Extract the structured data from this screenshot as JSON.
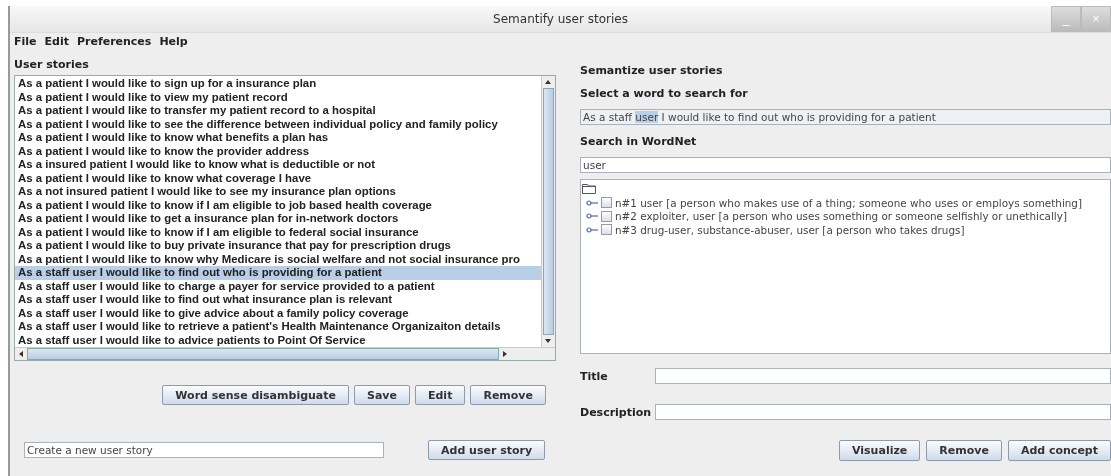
{
  "window": {
    "title": "Semantify user stories",
    "controls": [
      "_",
      "×"
    ]
  },
  "menu": [
    "File",
    "Edit",
    "Preferences",
    "Help"
  ],
  "user_stories": {
    "label": "User stories",
    "items": [
      {
        "text": "As a patient I would like to sign up for a insurance plan",
        "selected": false
      },
      {
        "text": "As a patient I would like to view my patient record",
        "selected": false
      },
      {
        "text": "As a patient I would like to transfer my patient record to a hospital",
        "selected": false
      },
      {
        "text": "As a patient I would like to see the difference between individual policy and family policy",
        "selected": false
      },
      {
        "text": "As a patient I would like to know what benefits a plan has",
        "selected": false
      },
      {
        "text": "As a patient I would like to know the provider address",
        "selected": false
      },
      {
        "text": "As a insured patient I would like to know what is deductible or not",
        "selected": false
      },
      {
        "text": "As a patient I would like to know what coverage I have",
        "selected": false
      },
      {
        "text": "As a not insured patient I would like to see my insurance plan options",
        "selected": false
      },
      {
        "text": "As a patient I would like to know if I am eligible to job based health coverage",
        "selected": false
      },
      {
        "text": "As a patient I would like to get a insurance plan for in-network doctors",
        "selected": false
      },
      {
        "text": "As a patient I would like to know if I am eligible to federal social insurance",
        "selected": false
      },
      {
        "text": "As a patient I would like to buy private insurance that pay for prescription drugs",
        "selected": false
      },
      {
        "text": "As a patient I would like to know why Medicare is social welfare and not social insurance pro",
        "selected": false
      },
      {
        "text": "As a staff user I would like to find out who is providing for a patient",
        "selected": true
      },
      {
        "text": "As a staff user I would like to charge a payer for service provided to a patient",
        "selected": false
      },
      {
        "text": "As a staff user I would like to find out what insurance plan is relevant",
        "selected": false
      },
      {
        "text": "As a staff user I would like to give advice about a family policy coverage",
        "selected": false
      },
      {
        "text": "As a staff user I would like to retrieve a patient's Health Maintenance Organizaiton details",
        "selected": false
      },
      {
        "text": "As a staff user I would like to advice patients to Point Of Service",
        "selected": false
      }
    ],
    "buttons": [
      "Word sense disambiguate",
      "Save",
      "Edit",
      "Remove"
    ],
    "new_story": {
      "value": "Create a new user story"
    },
    "add_button": "Add user story"
  },
  "semantize": {
    "heading": "Semantize user stories",
    "select_label": "Select a word to search for",
    "sentence": [
      {
        "text": "As a staff ",
        "selected": false
      },
      {
        "text": "user",
        "selected": true
      },
      {
        "text": " I would like to find out who is providing for a patient",
        "selected": false
      }
    ],
    "search_label": "Search in WordNet",
    "search": {
      "value": "user"
    },
    "senses": [
      {
        "text": "n#1 user [a person who makes use of a thing; someone who uses or employs something]",
        "checked": false
      },
      {
        "text": "n#2 exploiter, user [a person who uses something or someone selfishly or unethically]",
        "checked": false
      },
      {
        "text": "n#3 drug-user, substance-abuser, user [a person who takes drugs]",
        "checked": false
      }
    ],
    "title_label": "Title",
    "description_label": "Description",
    "buttons": [
      "Visualize",
      "Remove",
      "Add concept"
    ]
  }
}
